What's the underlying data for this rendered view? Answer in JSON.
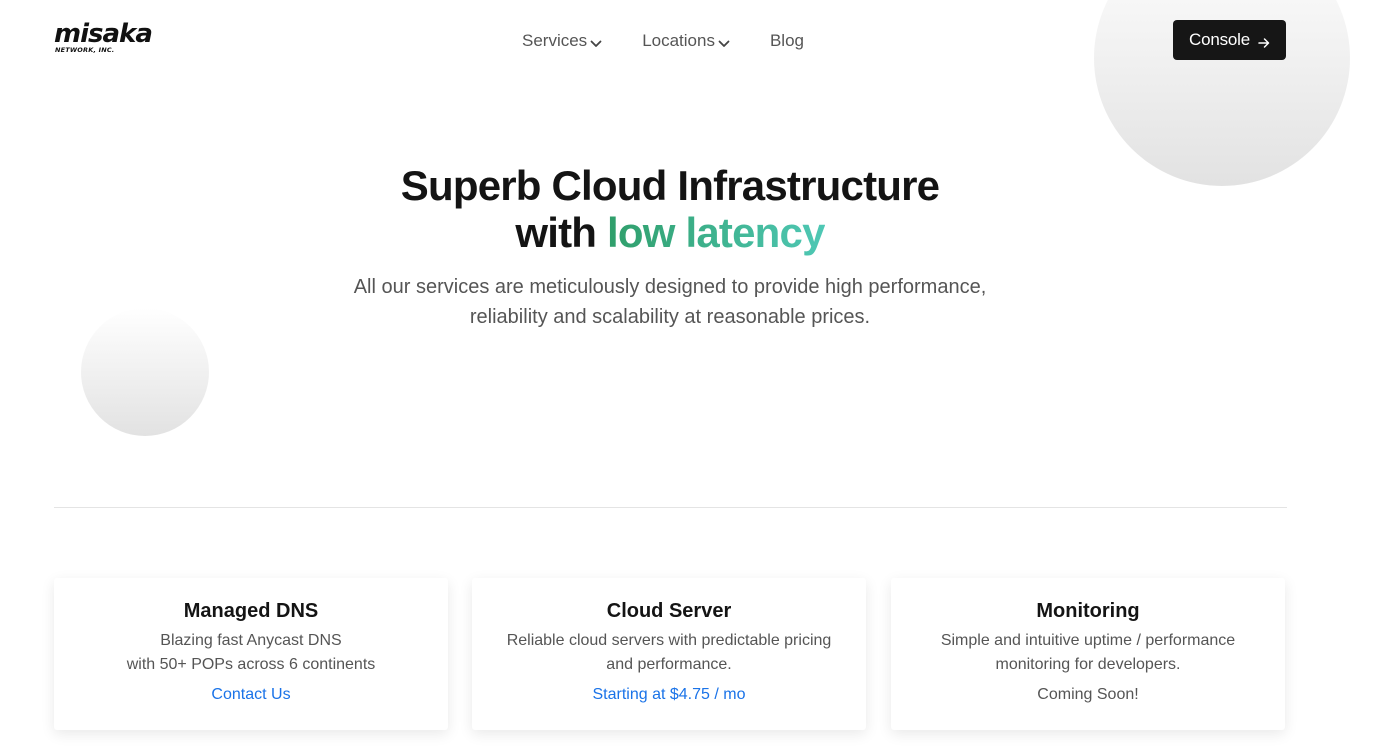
{
  "brand": {
    "name": "misaka",
    "subtitle": "NETWORK, INC."
  },
  "nav": {
    "items": [
      {
        "label": "Services",
        "icon": "chevron-down-icon"
      },
      {
        "label": "Locations",
        "icon": "chevron-down-icon"
      },
      {
        "label": "Blog"
      }
    ],
    "console_label": "Console",
    "console_icon": "arrow-right-icon"
  },
  "hero": {
    "title_line1": "Superb Cloud Infrastructure",
    "title_line2_prefix": "with ",
    "title_line2_accent": "low latency",
    "subtitle_line1": "All our services are meticulously designed to provide high performance,",
    "subtitle_line2": "reliability and scalability at reasonable prices."
  },
  "cards": [
    {
      "title": "Managed DNS",
      "desc_line1": "Blazing fast Anycast DNS",
      "desc_line2": "with 50+ POPs across 6 continents",
      "link": "Contact Us"
    },
    {
      "title": "Cloud Server",
      "desc_line1": "Reliable cloud servers with predictable pricing",
      "desc_line2": "and performance.",
      "link": "Starting at $4.75 / mo"
    },
    {
      "title": "Monitoring",
      "desc_line1": "Simple and intuitive uptime / performance",
      "desc_line2": "monitoring for developers.",
      "note": "Coming Soon!"
    }
  ],
  "colors": {
    "accent_start": "#2f9e6a",
    "accent_end": "#4fc8b5",
    "link": "#1a73e8",
    "button_bg": "#161616"
  }
}
